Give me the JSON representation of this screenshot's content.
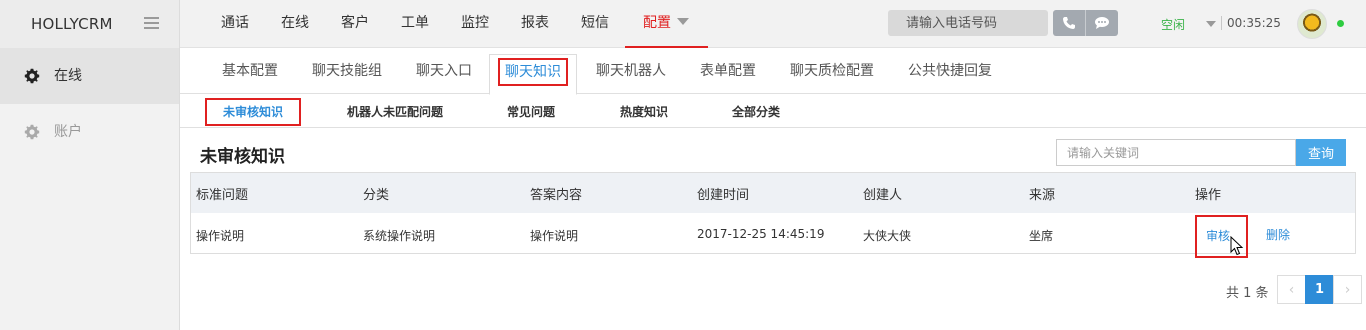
{
  "app": {
    "brand": "HOLLYCRM"
  },
  "topnav": {
    "items": [
      "通话",
      "在线",
      "客户",
      "工单",
      "监控",
      "报表",
      "短信"
    ],
    "active": "配置"
  },
  "header": {
    "phone_placeholder": "请输入电话号码",
    "status": "空闲",
    "timer": "00:35:25"
  },
  "sidebar": {
    "items": [
      {
        "label": "在线",
        "icon": "gear-icon",
        "active": true
      },
      {
        "label": "账户",
        "icon": "gear-icon",
        "active": false
      }
    ]
  },
  "subtabs": {
    "items": [
      "基本配置",
      "聊天技能组",
      "聊天入口",
      "聊天知识",
      "聊天机器人",
      "表单配置",
      "聊天质检配置",
      "公共快捷回复"
    ],
    "active_index": 3
  },
  "kbtabs": {
    "items": [
      "未审核知识",
      "机器人未匹配问题",
      "常见问题",
      "热度知识",
      "全部分类"
    ],
    "active_index": 0
  },
  "section": {
    "title": "未审核知识",
    "search_placeholder": "请输入关键词",
    "search_button": "查询"
  },
  "table": {
    "columns": [
      "标准问题",
      "分类",
      "答案内容",
      "创建时间",
      "创建人",
      "来源",
      "操作"
    ],
    "rows": [
      {
        "question": "操作说明",
        "category": "系统操作说明",
        "answer": "操作说明",
        "created": "2017-12-25 14:45:19",
        "creator": "大侠大侠",
        "source": "坐席",
        "actions": [
          "审核",
          "删除"
        ]
      }
    ]
  },
  "pagination": {
    "total_text": "共 1 条",
    "current_page": "1",
    "prev": "‹",
    "next": "›"
  },
  "colors": {
    "accent": "#2d8cd8",
    "active_red": "#e02020",
    "status_green": "#3cb34a"
  }
}
